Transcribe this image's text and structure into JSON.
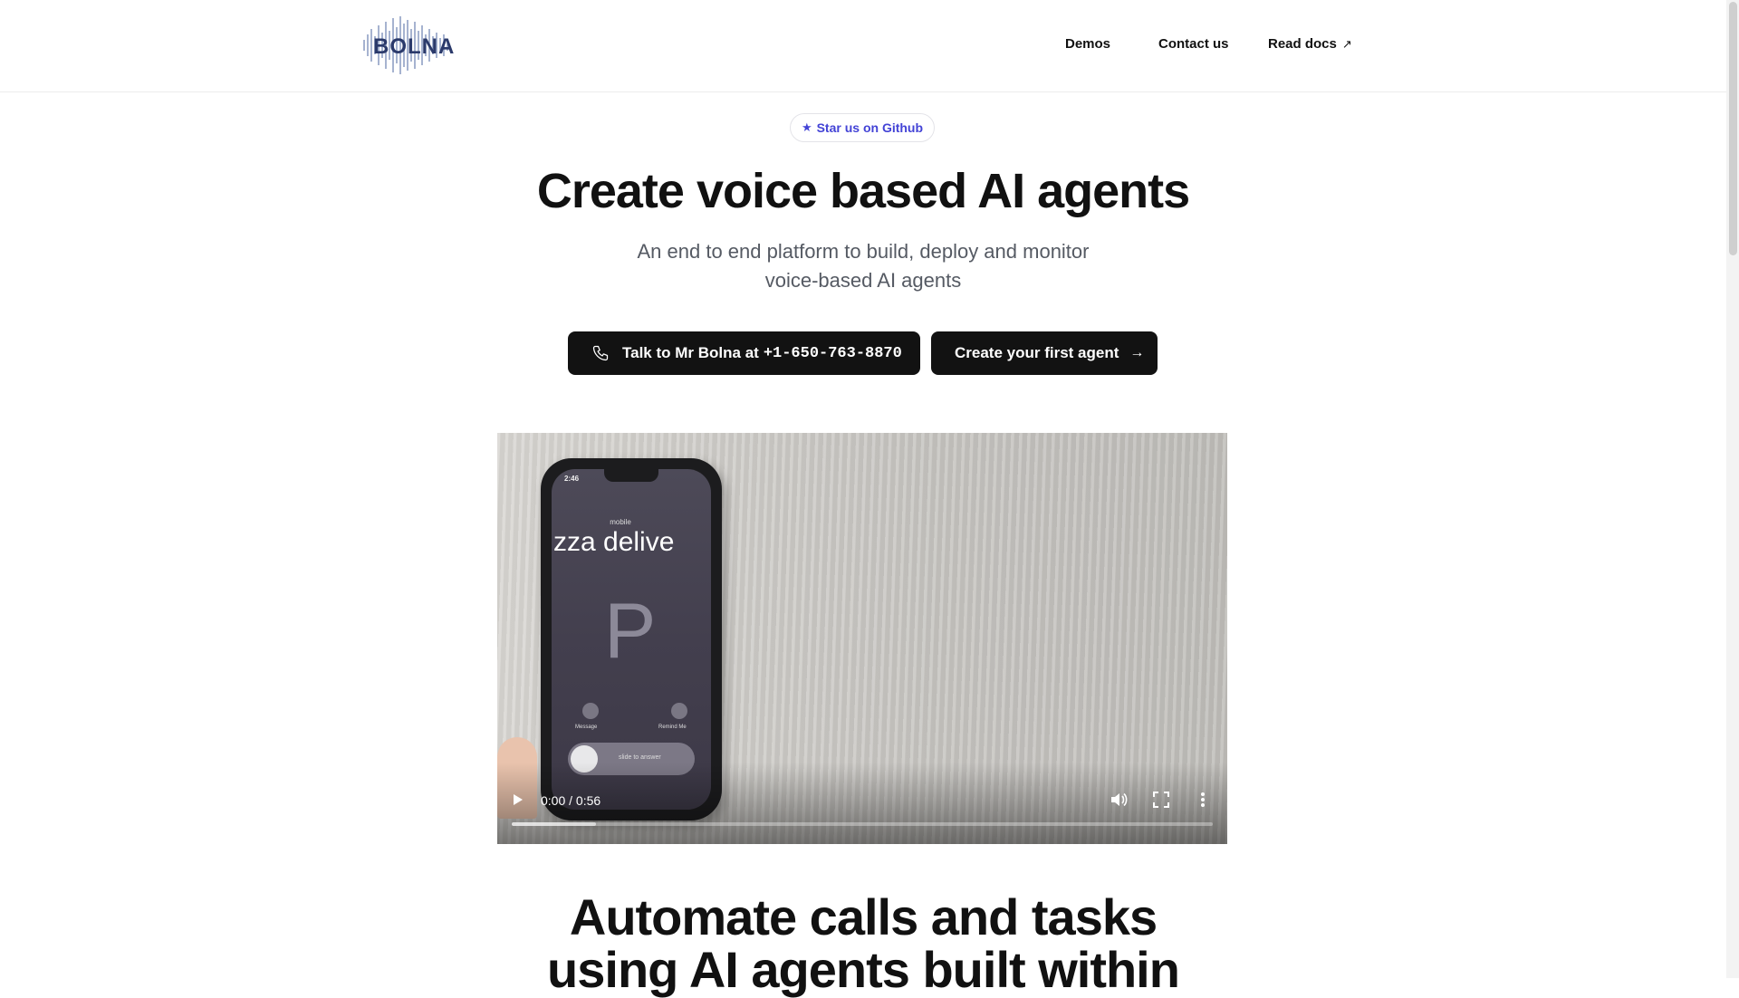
{
  "header": {
    "logo_text": "BOLNA",
    "nav": {
      "demos": "Demos",
      "contact": "Contact us",
      "docs": "Read docs"
    }
  },
  "badge": {
    "label": "Star us on Github",
    "icon": "star-icon"
  },
  "hero": {
    "title": "Create voice based AI agents",
    "subtitle_line1": "An end to end platform to build, deploy and monitor",
    "subtitle_line2": "voice-based AI agents"
  },
  "buttons": {
    "call_label": "Talk to Mr Bolna at",
    "call_number": "+1-650-763-8870",
    "create_label": "Create your first agent"
  },
  "video": {
    "time_display": "0:00 / 0:56",
    "buffered_fraction": 0.12,
    "phone": {
      "time": "2:46",
      "label": "mobile",
      "caller": "zza delive",
      "initial": "P",
      "btn1_label": "Message",
      "btn2_label": "Remind Me",
      "slide_text": "slide to answer"
    }
  },
  "section": {
    "title_line1": "Automate calls and tasks",
    "title_line2": "using AI agents built within"
  },
  "colors": {
    "accent": "#4343d6",
    "button_bg": "#121212",
    "text": "#111111",
    "muted": "#555a63"
  }
}
